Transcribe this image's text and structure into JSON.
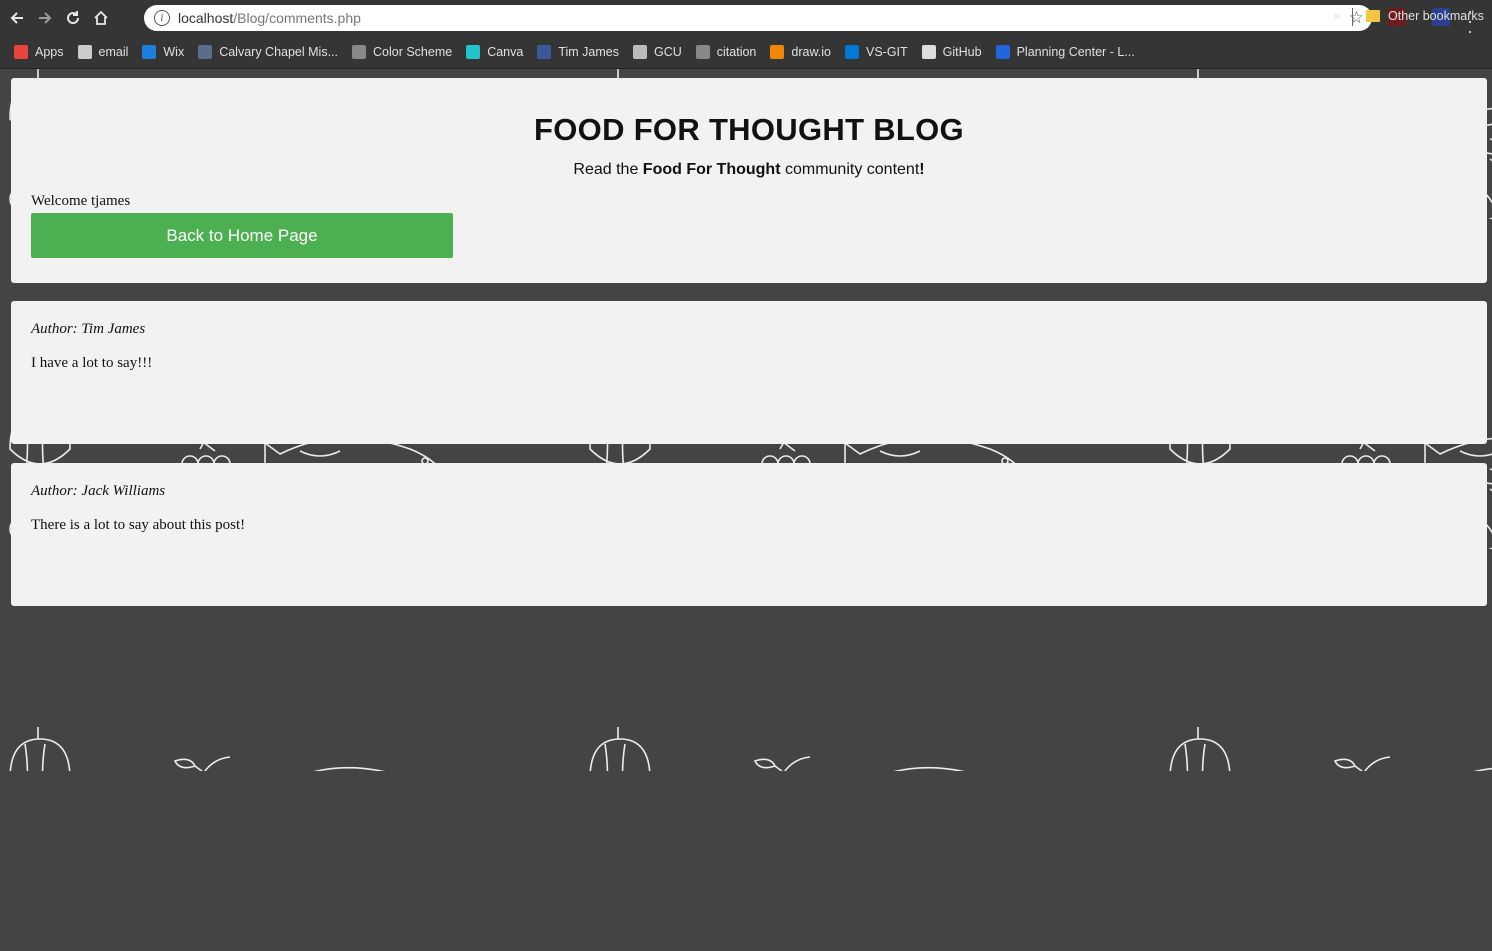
{
  "browser": {
    "url_host": "localhost",
    "url_path": "/Blog/comments.php",
    "back_icon": "arrow-left-icon",
    "forward_icon": "arrow-right-icon",
    "reload_icon": "reload-icon",
    "home_icon": "home-icon",
    "bookmarks": [
      {
        "label": "Apps",
        "color": "#e8453c"
      },
      {
        "label": "email",
        "color": "#cccccc"
      },
      {
        "label": "Wix",
        "color": "#1e7ee0"
      },
      {
        "label": "Calvary Chapel Mis...",
        "color": "#5a6e8c"
      },
      {
        "label": "Color Scheme",
        "color": "#888888"
      },
      {
        "label": "Canva",
        "color": "#20c4cb"
      },
      {
        "label": "Tim James",
        "color": "#3b5998"
      },
      {
        "label": "GCU",
        "color": "#bbbbbb"
      },
      {
        "label": "citation",
        "color": "#888888"
      },
      {
        "label": "draw.io",
        "color": "#f08705"
      },
      {
        "label": "VS-GIT",
        "color": "#0078d7"
      },
      {
        "label": "GitHub",
        "color": "#dddddd"
      },
      {
        "label": "Planning Center - L...",
        "color": "#2266dd"
      }
    ],
    "more_label": "»",
    "other_bookmarks": "Other bookmarks"
  },
  "header": {
    "title": "FOOD FOR THOUGHT BLOG",
    "subtitle_pre": "Read the ",
    "subtitle_bold": "Food For Thought",
    "subtitle_post": " community content",
    "subtitle_end": "!",
    "welcome": "Welcome tjames",
    "home_button": "Back to Home Page"
  },
  "comments": [
    {
      "author": "Author: Tim James",
      "text": "I have a lot to say!!!"
    },
    {
      "author": "Author: Jack Williams",
      "text": "There is a lot to say about this post!"
    }
  ],
  "colors": {
    "accent": "#4caf50",
    "background": "#444444",
    "panel": "#f2f2f2"
  }
}
